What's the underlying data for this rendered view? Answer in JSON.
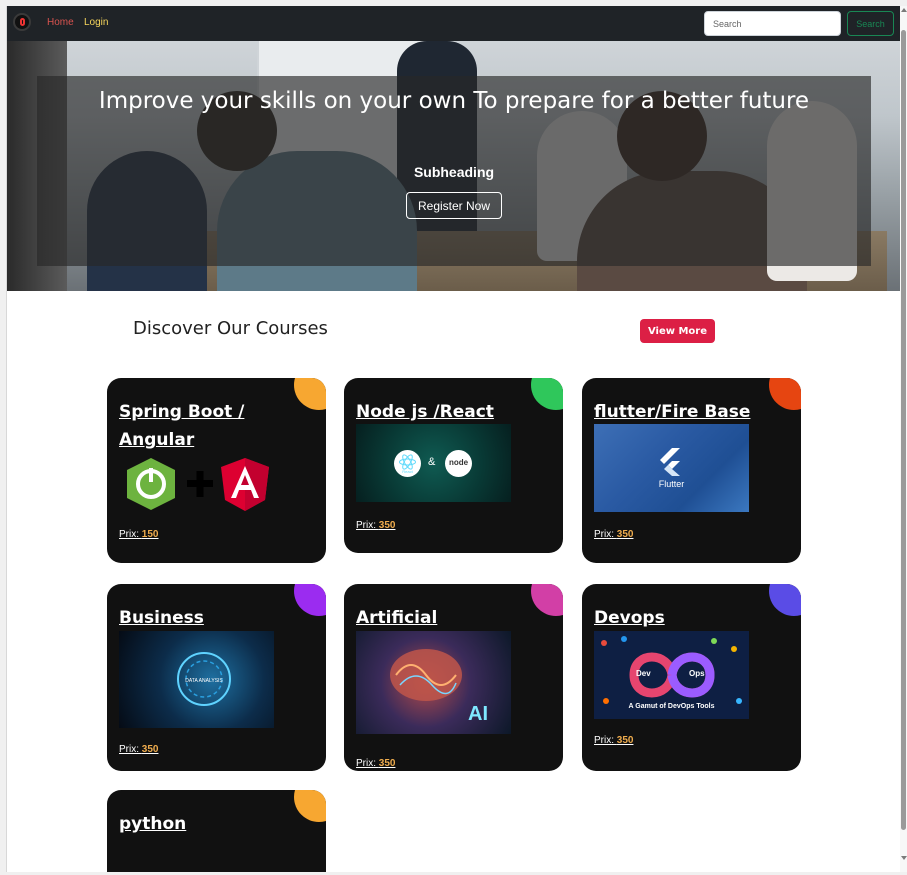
{
  "nav": {
    "home": "Home",
    "login": "Login",
    "search_placeholder": "Search",
    "search_button": "Search"
  },
  "hero": {
    "title": "Improve your skills on your own To prepare for a better future",
    "subheading": "Subheading",
    "register": "Register Now"
  },
  "courses": {
    "heading": "Discover Our Courses",
    "view_more": "View More",
    "price_label": "Prix:",
    "items": [
      {
        "title": "Spring Boot / Angular",
        "price": "150",
        "accent": "#f7a731"
      },
      {
        "title": "Node js /React",
        "price": "350",
        "accent": "#2fc75b"
      },
      {
        "title": "flutter/Fire Base",
        "price": "350",
        "accent": "#e64511"
      },
      {
        "title": "Business intellegence",
        "price": "350",
        "accent": "#9b2cf0"
      },
      {
        "title": "Artificial intellegence",
        "price": "350",
        "accent": "#d23fa6"
      },
      {
        "title": "Devops",
        "price": "350",
        "accent": "#5a4ce6"
      },
      {
        "title": "python",
        "price": "",
        "accent": "#f7a731"
      }
    ]
  },
  "images": {
    "react": "React",
    "amp": "&",
    "node": "node",
    "flutter": "Flutter",
    "bi": "DATA ANALYSIS",
    "ai": "AI",
    "devops_dev": "Dev",
    "devops_ops": "Ops",
    "devops_caption": "A Gamut of DevOps Tools"
  },
  "colors": {
    "nav_bg": "#1f2327",
    "card_bg": "#111111",
    "view_more_bg": "#dc1f45",
    "price_value": "#f0ad4e",
    "home_link": "#d9534f",
    "login_link": "#f6d55c",
    "search_button": "#198754"
  }
}
